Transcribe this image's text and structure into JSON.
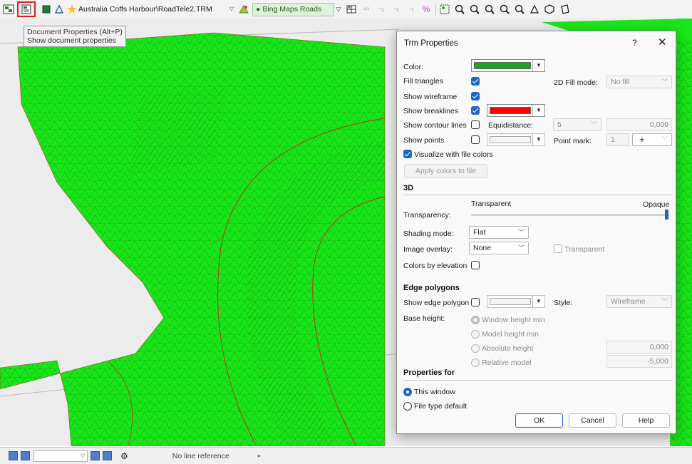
{
  "toolbar": {
    "file_combo": "Australia Coffs Harbour\\RoadTele2.TRM",
    "map_combo": "Bing Maps Roads",
    "tooltip_line1": "Document Properties (Alt+P)",
    "tooltip_line2": "Show document properties"
  },
  "status": {
    "line_reference": "No line reference"
  },
  "dialog": {
    "title": "Trm Properties",
    "help_label": "?",
    "close_label": "✕",
    "color_label": "Color:",
    "fill_triangles_label": "Fill triangles",
    "fill_mode_label": "2D Fill mode:",
    "fill_mode_value": "No fill",
    "show_wireframe_label": "Show wireframe",
    "show_breaklines_label": "Show breaklines",
    "show_contour_label": "Show contour lines",
    "equidistance_label": "Equidistance:",
    "equidistance_value": "5",
    "contour_value": "0,000",
    "show_points_label": "Show points",
    "point_mark_label": "Point mark:",
    "point_mark_size": "1",
    "point_mark_symbol": "+",
    "visualize_label": "Visualize with file colors",
    "apply_colors_label": "Apply colors to file",
    "section_3d": "3D",
    "transparent_label": "Transparent",
    "opaque_label": "Opaque",
    "transparency_label": "Transparency:",
    "transparency_level": 1.0,
    "shading_label": "Shading mode:",
    "shading_value": "Flat",
    "image_overlay_label": "Image overlay:",
    "image_overlay_value": "None",
    "transparent_check_label": "Transparent",
    "colors_by_elevation_label": "Colors by elevation",
    "section_edge": "Edge polygons",
    "show_edge_label": "Show edge polygon",
    "style_label": "Style:",
    "style_value": "Wireframe",
    "base_height_label": "Base height:",
    "radio_window_height": "Window height min",
    "radio_model_height": "Model height min",
    "radio_absolute": "Absolute height",
    "radio_relative": "Relative model",
    "absolute_value": "0,000",
    "relative_value": "-5,000",
    "section_props_for": "Properties for",
    "radio_this_window": "This window",
    "radio_file_type": "File type default",
    "ok_label": "OK",
    "cancel_label": "Cancel",
    "help_button_label": "Help"
  },
  "colors": {
    "trm_color": "#1ea41e",
    "breakline_color": "#ff0000",
    "terrain_green": "#19e619",
    "accent": "#1d66c9"
  },
  "checkbox_states": {
    "fill_triangles": true,
    "show_wireframe": true,
    "show_breaklines": true,
    "show_contour_lines": false,
    "show_points": false,
    "visualize_with_file_colors": true,
    "transparent": false,
    "colors_by_elevation": false,
    "show_edge_polygon": false
  }
}
